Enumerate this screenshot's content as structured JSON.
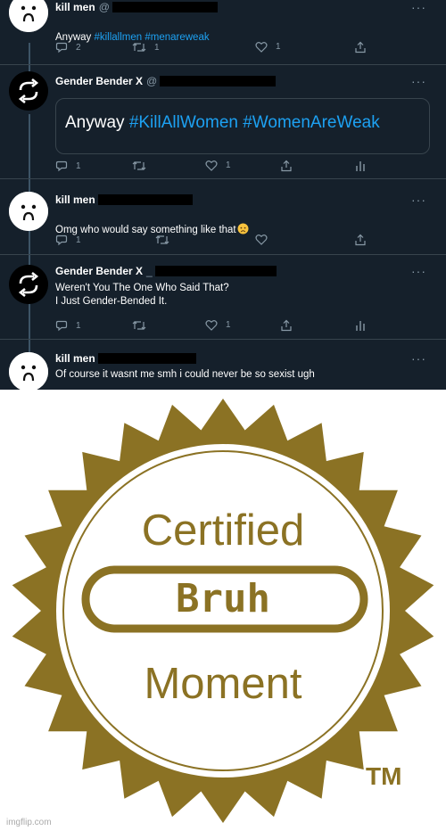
{
  "colors": {
    "bg": "#15202b",
    "text": "#ffffff",
    "muted": "#8899a6",
    "link": "#1da1f2",
    "border": "#38444d",
    "gold": "#8b7224"
  },
  "tweets": [
    {
      "name": "kill men",
      "handle": "@",
      "more_icon": "more-horizontal-icon",
      "text_plain": "Anyway ",
      "hashtags": "#killallmen #menareweak",
      "avatar": "sad-face-avatar",
      "counts": {
        "reply": "2",
        "retweet": "1",
        "like": "1"
      }
    },
    {
      "name": "Gender Bender X",
      "handle": "@",
      "avatar": "swap-arrows-avatar",
      "card": {
        "plain": "Anyway ",
        "hashtags": "#KillAllWomen #WomenAreWeak"
      },
      "counts": {
        "reply": "1",
        "retweet": "",
        "like": "1"
      }
    },
    {
      "name": "kill men",
      "avatar": "sad-face-avatar",
      "text": "Omg who would say something like that",
      "emoji": "worried-face-emoji",
      "counts": {
        "reply": "1",
        "retweet": "",
        "like": ""
      }
    },
    {
      "name": "Gender Bender X",
      "handle": "_",
      "avatar": "swap-arrows-avatar",
      "text": "Weren't You The One Who Said That?\nI Just Gender-Bended It.",
      "counts": {
        "reply": "1",
        "retweet": "",
        "like": "1"
      }
    },
    {
      "name": "kill men",
      "avatar": "sad-face-avatar",
      "text": "Of course it wasnt me smh i could never be so sexist ugh"
    }
  ],
  "badge": {
    "top": "Certified",
    "center": "Bruh",
    "bottom": "Moment",
    "tm": "TM"
  },
  "watermark": "imgflip.com"
}
